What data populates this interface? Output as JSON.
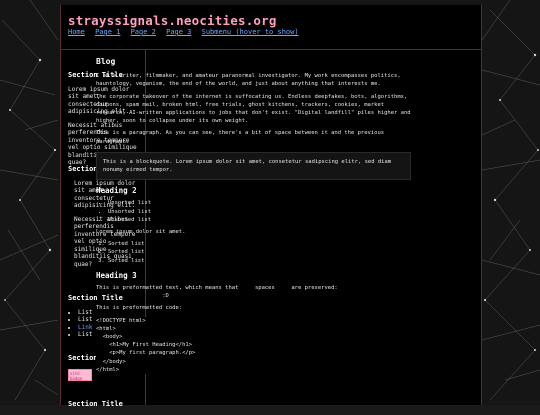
{
  "site": {
    "title": "strayssignals.neocities.org"
  },
  "nav": {
    "items": [
      "Home",
      "Page 1",
      "Page 2",
      "Page 3",
      "Submenu (hover to show)"
    ]
  },
  "sidebar": {
    "sections": [
      {
        "title": "Section Title",
        "p1": "Lorem ipsum dolor sit amet, consectetur adipisicing elit.",
        "p2": "Necessit atibus perferendis inventore tempore vel optio similique blanditiis quasi quae?"
      },
      {
        "title": "Section Title",
        "p1": "Lorem ipsum dolor sit amet, consectetur adipisicing elit.",
        "p2": "Necessit atibus perferendis inventore tempore vel optio similique blanditiis quasi quae?"
      },
      {
        "title": "Section Title",
        "items": [
          "List",
          "List",
          "Link",
          "List"
        ]
      },
      {
        "title": "Section Title",
        "badge": "site badge"
      },
      {
        "title": "Section Title"
      }
    ]
  },
  "main": {
    "h1": "Blog",
    "p1": "I am a writer, filmmaker, and amateur paranormal investigator. My work encompasses politics, hauntology, veganism, the end of the world, and just about anything that interests me.",
    "p2": "The corporate takeover of the internet is suffocating us. Endless deepfakes, bots, algorithms, coupons, spam mail, broken html, free trials, ghost kitchens, trackers, cookies, market research, AI-written applications to jobs that don't exist. \"Digital landfill\" piles higher and higher, soon to collapse under its own weight.",
    "p3": "This is a paragraph. As you can see, there's a bit of space between it and the previous paragraph.",
    "blockquote": "This is a blockquote. Lorem ipsum dolor sit amet, consetetur sadipscing elitr, sed diam nonumy eirmod tempor.",
    "h2": "Heading 2",
    "ul": [
      "Unsorted list",
      "Unsorted list",
      "Unsorted list"
    ],
    "p4": "Lorem ipsum dolor sit amet.",
    "ol": [
      "Sorted list",
      "Sorted list",
      "Sorted list"
    ],
    "h3": "Heading 3",
    "pre1": "This is preformatted text, which means that     spaces     are preserved:\n                    :D",
    "p5": "This is preformatted code:",
    "code": "<!DOCTYPE html>\n<html>\n  <body>\n    <h1>My First Heading</h1>\n    <p>My first paragraph.</p>\n  </body>\n</html>"
  },
  "colors": {
    "accent": "#ff9fc0",
    "link": "#6fa3ff",
    "border": "#5a2a3a"
  }
}
